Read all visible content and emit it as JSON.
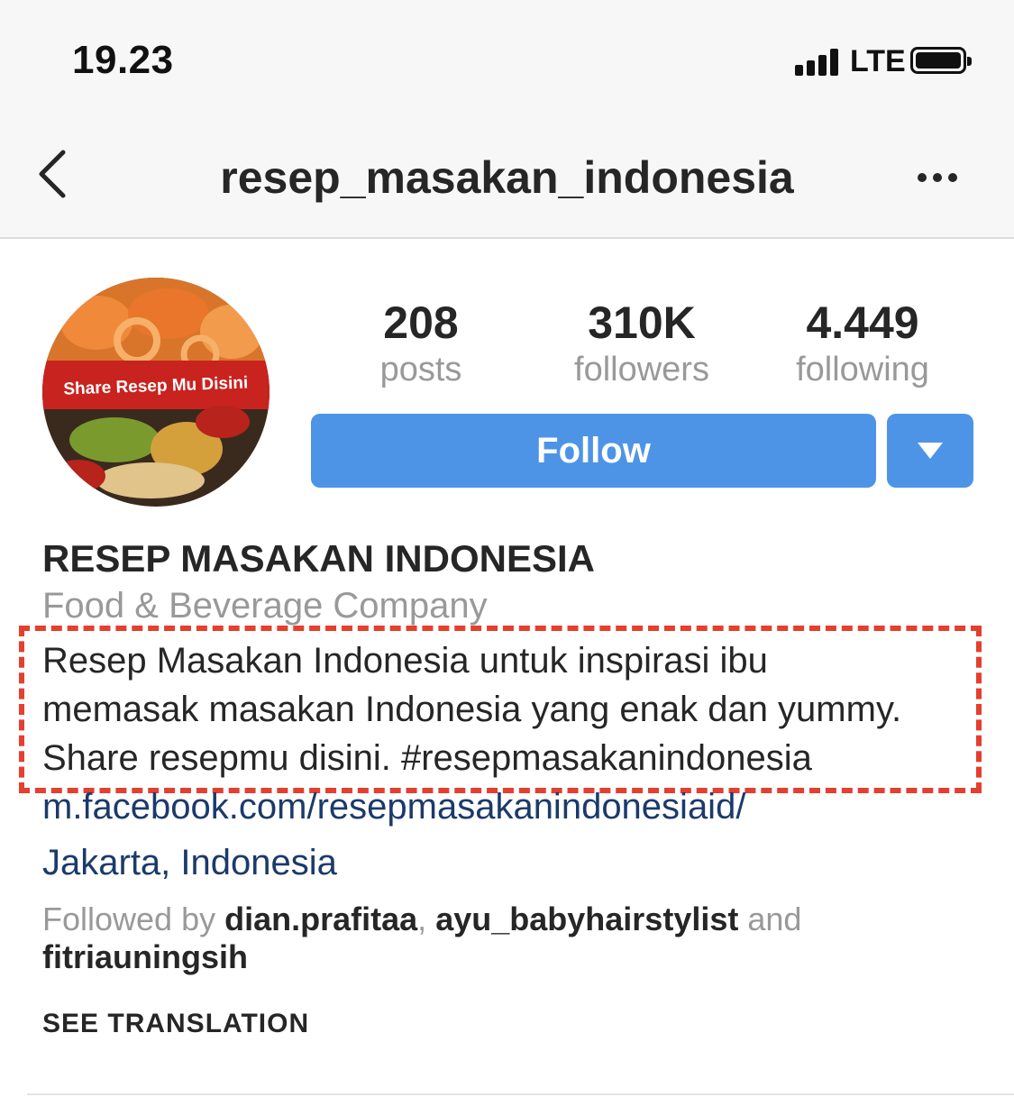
{
  "status_bar": {
    "time": "19.23",
    "network": "LTE"
  },
  "header": {
    "username": "resep_masakan_indonesia"
  },
  "profile": {
    "avatar_text": "Share Resep Mu Disini",
    "stats": [
      {
        "value": "208",
        "label": "posts"
      },
      {
        "value": "310K",
        "label": "followers"
      },
      {
        "value": "4.449",
        "label": "following"
      }
    ],
    "follow_label": "Follow",
    "name": "RESEP MASAKAN INDONESIA",
    "category": "Food & Beverage Company",
    "bio_lines": [
      "Resep Masakan Indonesia untuk inspirasi ibu",
      "memasak masakan Indonesia yang enak dan yummy.",
      "Share resepmu disini. #resepmasakanindonesia"
    ],
    "website": "m.facebook.com/resepmasakanindonesiaid/",
    "location": "Jakarta, Indonesia",
    "followed_by": {
      "prefix": "Followed by",
      "users": [
        "dian.prafitaa",
        "ayu_babyhairstylist",
        "fitriauningsih"
      ],
      "separator": ",",
      "and": "and"
    },
    "see_translation": "SEE TRANSLATION"
  },
  "colors": {
    "follow_blue": "#4d94e7",
    "highlight_red": "#e43f2f",
    "link_blue": "#1b3a6b"
  }
}
